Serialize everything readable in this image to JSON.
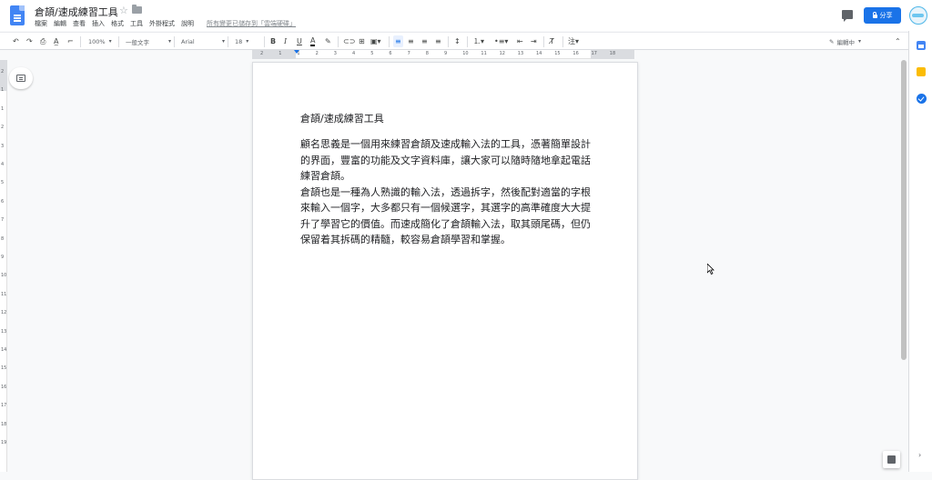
{
  "header": {
    "title": "倉頡/速成練習工具",
    "menu": [
      "檔案",
      "編輯",
      "查看",
      "插入",
      "格式",
      "工具",
      "外掛程式",
      "說明"
    ],
    "saved_note": "所有變更已儲存到「雲端硬碟」",
    "share_label": "分享"
  },
  "toolbar": {
    "zoom": "100%",
    "style": "一般文字",
    "font": "Arial",
    "font_size": "18",
    "mode": "編輯中"
  },
  "ruler": {
    "numbers": [
      "2",
      "1",
      "1",
      "2",
      "3",
      "4",
      "5",
      "6",
      "7",
      "8",
      "9",
      "10",
      "11",
      "12",
      "13",
      "14",
      "15",
      "16",
      "17",
      "18"
    ]
  },
  "vruler": {
    "numbers": [
      "2",
      "1",
      "1",
      "2",
      "3",
      "4",
      "5",
      "6",
      "7",
      "8",
      "9",
      "10",
      "11",
      "12",
      "13",
      "14",
      "15",
      "16",
      "17",
      "18",
      "19"
    ]
  },
  "document": {
    "heading": "倉頡/速成練習工具",
    "paragraphs": [
      "顧名思義是一個用來練習倉頡及速成輸入法的工具，憑著簡單設計的界面，豐富的功能及文字資料庫，讓大家可以隨時隨地拿起電話練習倉頡。",
      "倉頡也是一種為人熟識的輸入法，透過拆字，然後配對適當的字根來輸入一個字，大多都只有一個候選字，其選字的高準確度大大提升了學習它的價值。而速成簡化了倉頡輸入法，取其頭尾碼，但仍保留着其拆碼的精髓，較容易倉頡學習和掌握。"
    ]
  },
  "colors": {
    "accent": "#1a73e8",
    "page_bg": "#ffffff",
    "app_bg": "#f8f9fa"
  }
}
